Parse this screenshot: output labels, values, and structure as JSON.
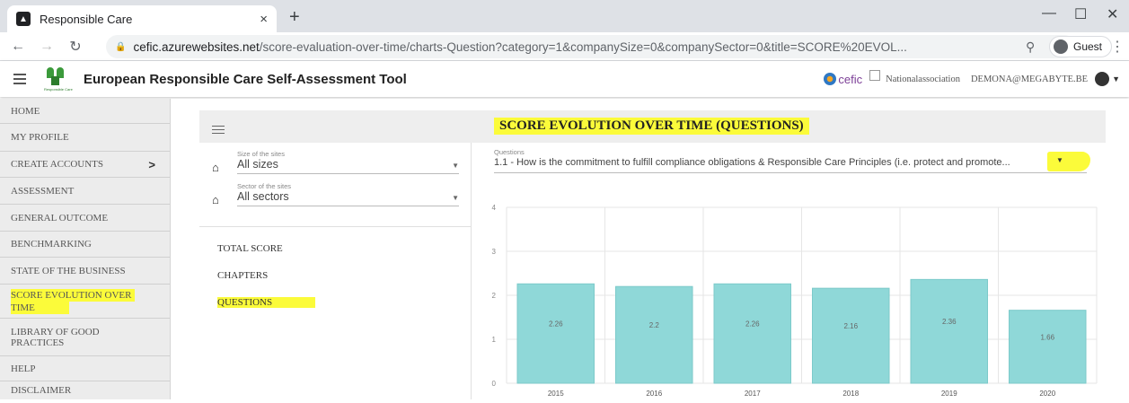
{
  "browser": {
    "tab_title": "Responsible Care",
    "tab_close": "×",
    "new_tab": "+",
    "minimize": "—",
    "maximize": "☐",
    "close": "✕",
    "url_host": "cefic.azurewebsites.net",
    "url_path": "/score-evaluation-over-time/charts-Question?category=1&companySize=0&companySector=0&title=SCORE%20EVOL...",
    "profile_label": "Guest"
  },
  "app": {
    "title": "European Responsible Care Self-Assessment Tool",
    "logo_text": "Responsible Care",
    "partner_logo": "cefic",
    "association": "Nationalassociation",
    "user_email": "DEMONA@MEGABYTE.BE"
  },
  "sidebar": {
    "items": [
      {
        "label": "HOME"
      },
      {
        "label": "MY PROFILE"
      },
      {
        "label": "CREATE ACCOUNTS",
        "chevron": ">"
      },
      {
        "label": "ASSESSMENT"
      },
      {
        "label": "GENERAL OUTCOME"
      },
      {
        "label": "BENCHMARKING"
      },
      {
        "label": "STATE OF THE BUSINESS"
      },
      {
        "label_line1": "SCORE EVOLUTION OVER",
        "label_line2": "TIME"
      },
      {
        "label_line1": "LIBRARY OF GOOD",
        "label_line2": "PRACTICES"
      },
      {
        "label": "HELP"
      },
      {
        "label": "DISCLAIMER"
      }
    ]
  },
  "panel": {
    "title": "SCORE EVOLUTION OVER TIME (QUESTIONS)",
    "filters": {
      "size_label": "Size of the sites",
      "size_value": "All sizes",
      "sector_label": "Sector of the sites",
      "sector_value": "All sectors"
    },
    "links": {
      "total": "TOTAL SCORE",
      "chapters": "CHAPTERS",
      "questions": "QUESTIONS"
    },
    "question": {
      "label": "Questions",
      "value": "1.1 - How is the commitment to fulfill compliance obligations & Responsible Care Principles (i.e. protect and promote..."
    }
  },
  "chart_data": {
    "type": "bar",
    "categories": [
      "2015",
      "2016",
      "2017",
      "2018",
      "2019",
      "2020"
    ],
    "values": [
      2.26,
      2.2,
      2.26,
      2.16,
      2.36,
      1.66
    ],
    "ylim": [
      0,
      4
    ],
    "yticks": [
      "0",
      "1",
      "2",
      "3",
      "4"
    ],
    "grid": true,
    "bar_color": "#8fd8d8",
    "bar_border": "#7ccaca"
  },
  "colors": {
    "highlight": "#fbfb3a",
    "sidebar_bg": "#ececec",
    "panel_header_bg": "#eeeeee"
  }
}
